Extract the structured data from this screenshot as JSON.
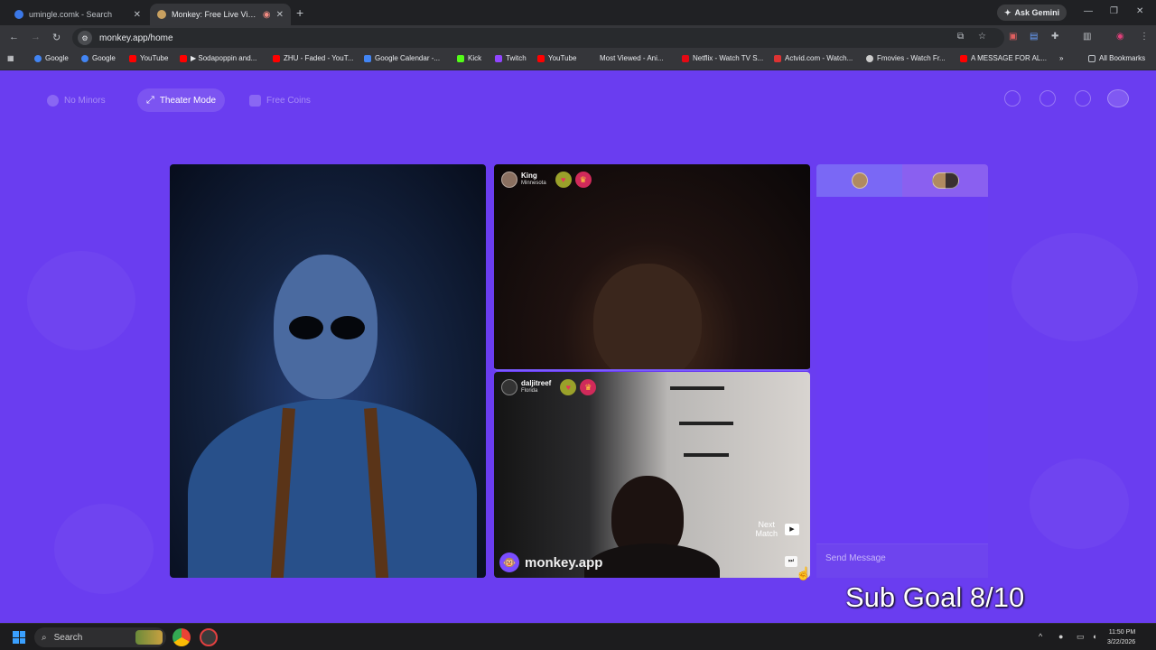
{
  "browser": {
    "tabs": [
      {
        "title": "umingle.comk - Search",
        "active": false
      },
      {
        "title": "Monkey: Free Live Video Ch",
        "active": true
      }
    ],
    "new_tab": "+",
    "ask_gemini": "Ask Gemini",
    "url": "monkey.app/home",
    "bookmarks": [
      {
        "label": "Google",
        "color": "#4285f4"
      },
      {
        "label": "Google",
        "color": "#4285f4"
      },
      {
        "label": "YouTube",
        "color": "#ff0000"
      },
      {
        "label": "▶ Sodapoppin and...",
        "color": "#ff0000"
      },
      {
        "label": "ZHU - Faded - YouT...",
        "color": "#ff0000"
      },
      {
        "label": "Google Calendar -...",
        "color": "#4285f4"
      },
      {
        "label": "Kick",
        "color": "#53fc18"
      },
      {
        "label": "Twitch",
        "color": "#9146ff"
      },
      {
        "label": "YouTube",
        "color": "#ff0000"
      },
      {
        "label": "Most Viewed - Ani...",
        "color": "#888888"
      },
      {
        "label": "Netflix - Watch TV S...",
        "color": "#e50914"
      },
      {
        "label": "Actvid.com - Watch...",
        "color": "#d33"
      },
      {
        "label": "Fmovies - Watch Fr...",
        "color": "#cccccc"
      },
      {
        "label": "A MESSAGE FOR AL...",
        "color": "#ff0000"
      }
    ],
    "bookmarks_more": "»",
    "all_bookmarks": "All Bookmarks"
  },
  "nav": {
    "no_minors": "No Minors",
    "theater_mode": "Theater Mode",
    "free_coins": "Free Coins"
  },
  "peers": [
    {
      "name": "King",
      "location": "Minnesota"
    },
    {
      "name": "daljitreef",
      "location": "Florida"
    }
  ],
  "brand": "monkey.app",
  "next_match": {
    "line1": "Next",
    "line2": "Match"
  },
  "chat": {
    "placeholder": "Send Message"
  },
  "overlay": {
    "sub_goal": "Sub Goal 8/10"
  },
  "taskbar": {
    "search": "Search",
    "time": "11:50 PM",
    "date": "3/22/2026"
  },
  "colors": {
    "accent": "#6a3df0",
    "heart_badge": "#9aa12a",
    "crown_badge": "#d02a5a"
  }
}
